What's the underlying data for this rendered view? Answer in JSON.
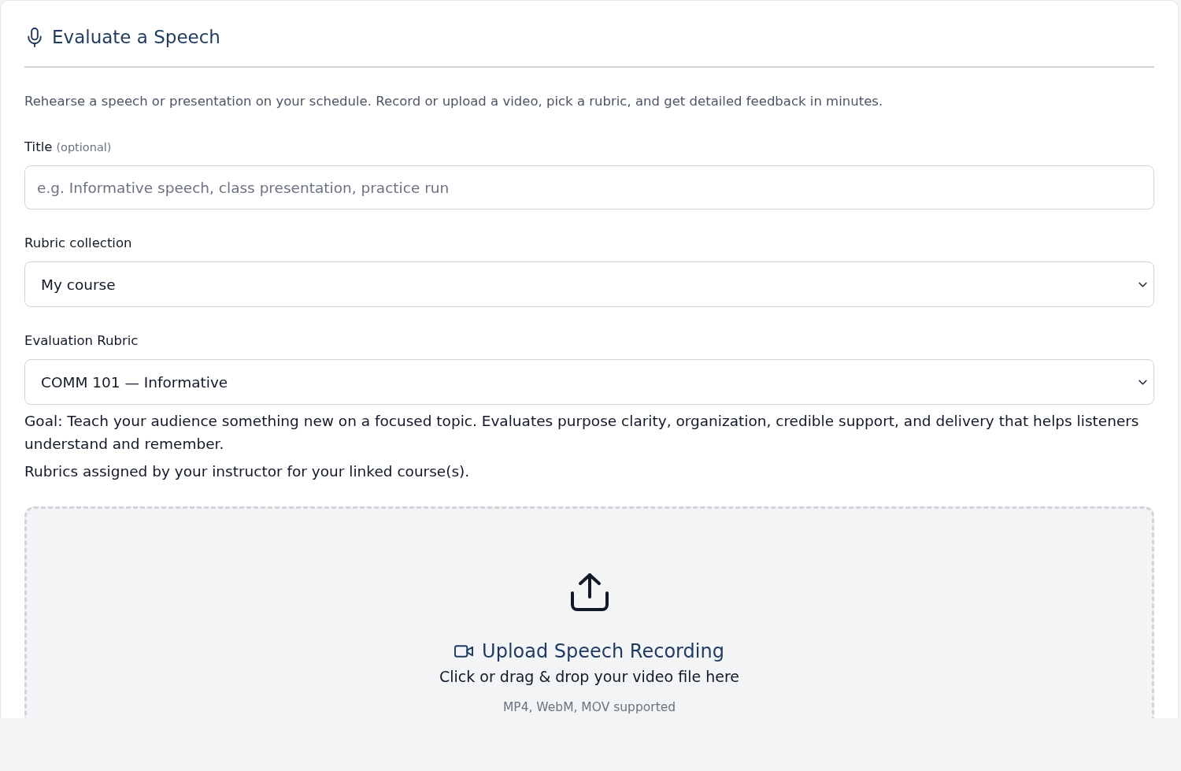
{
  "header": {
    "title": "Evaluate a Speech"
  },
  "description": "Rehearse a speech or presentation on your schedule. Record or upload a video, pick a rubric, and get detailed feedback in minutes.",
  "fields": [
    {
      "kind": "text",
      "label": "Title",
      "label_note": "(optional)",
      "placeholder": "e.g. Informative speech, class presentation, practice run"
    },
    {
      "kind": "select",
      "label": "Rubric collection",
      "value": "My course"
    },
    {
      "kind": "select",
      "label": "Evaluation Rubric",
      "value": "COMM 101 — Informative",
      "notes": [
        "Goal: Teach your audience something new on a focused topic. Evaluates purpose clarity, organization, credible support, and delivery that helps listeners understand and remember.",
        "Rubrics assigned by your instructor for your linked course(s)."
      ]
    }
  ],
  "upload": {
    "title": "Upload Speech Recording",
    "instruction": "Click or drag & drop your video file here",
    "formats": "MP4, WebM, MOV supported"
  }
}
